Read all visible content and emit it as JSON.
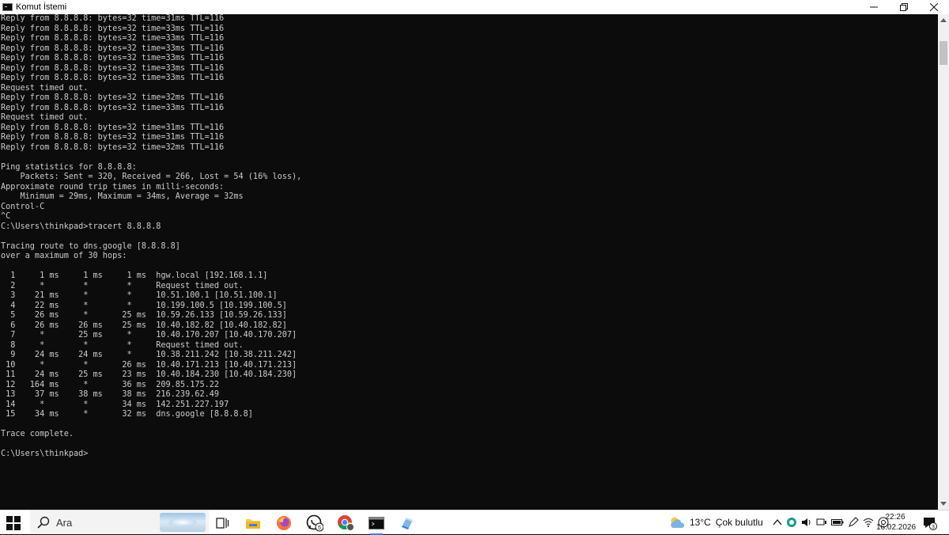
{
  "window": {
    "title": "Komut İstemi"
  },
  "console": {
    "lines": [
      "Reply from 8.8.8.8: bytes=32 time=31ms TTL=116",
      "Reply from 8.8.8.8: bytes=32 time=33ms TTL=116",
      "Reply from 8.8.8.8: bytes=32 time=33ms TTL=116",
      "Reply from 8.8.8.8: bytes=32 time=33ms TTL=116",
      "Reply from 8.8.8.8: bytes=32 time=33ms TTL=116",
      "Reply from 8.8.8.8: bytes=32 time=33ms TTL=116",
      "Reply from 8.8.8.8: bytes=32 time=33ms TTL=116",
      "Request timed out.",
      "Reply from 8.8.8.8: bytes=32 time=32ms TTL=116",
      "Reply from 8.8.8.8: bytes=32 time=33ms TTL=116",
      "Request timed out.",
      "Reply from 8.8.8.8: bytes=32 time=31ms TTL=116",
      "Reply from 8.8.8.8: bytes=32 time=31ms TTL=116",
      "Reply from 8.8.8.8: bytes=32 time=32ms TTL=116",
      "",
      "Ping statistics for 8.8.8.8:",
      "    Packets: Sent = 320, Received = 266, Lost = 54 (16% loss),",
      "Approximate round trip times in milli-seconds:",
      "    Minimum = 29ms, Maximum = 34ms, Average = 32ms",
      "Control-C",
      "^C",
      "C:\\Users\\thinkpad>tracert 8.8.8.8",
      "",
      "Tracing route to dns.google [8.8.8.8]",
      "over a maximum of 30 hops:",
      "",
      "  1     1 ms     1 ms     1 ms  hgw.local [192.168.1.1]",
      "  2     *        *        *     Request timed out.",
      "  3    21 ms     *        *     10.51.100.1 [10.51.100.1]",
      "  4    22 ms     *        *     10.199.100.5 [10.199.100.5]",
      "  5    26 ms     *       25 ms  10.59.26.133 [10.59.26.133]",
      "  6    26 ms    26 ms    25 ms  10.40.182.82 [10.40.182.82]",
      "  7     *       25 ms     *     10.40.170.207 [10.40.170.207]",
      "  8     *        *        *     Request timed out.",
      "  9    24 ms    24 ms     *     10.38.211.242 [10.38.211.242]",
      " 10     *        *       26 ms  10.40.171.213 [10.40.171.213]",
      " 11    24 ms    25 ms    23 ms  10.40.184.230 [10.40.184.230]",
      " 12   164 ms     *       36 ms  209.85.175.22",
      " 13    37 ms    38 ms    38 ms  216.239.62.49",
      " 14     *        *       34 ms  142.251.227.197",
      " 15    34 ms     *       32 ms  dns.google [8.8.8.8]",
      "",
      "Trace complete.",
      "",
      "C:\\Users\\thinkpad>"
    ]
  },
  "taskbar": {
    "search_placeholder": "Ara",
    "whatsapp_badge": "5",
    "weather_temp": "13°C",
    "weather_desc": "Çok bulutlu",
    "time": "22:26",
    "date": "16.02.2026",
    "notification_count": "3",
    "icons": [
      "windows-start-icon",
      "search-icon",
      "task-view-icon",
      "file-explorer-icon",
      "firefox-icon",
      "whatsapp-icon",
      "chrome-icon",
      "command-prompt-icon",
      "app-icon"
    ]
  },
  "colors": {
    "console_bg": "#0c0c0c",
    "console_fg": "#cccccc",
    "accent": "#3a82d6"
  }
}
